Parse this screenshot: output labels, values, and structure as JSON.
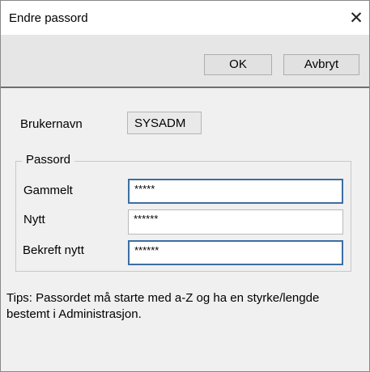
{
  "window": {
    "title": "Endre passord",
    "close_glyph": "✕",
    "close_icon": "close-icon"
  },
  "toolbar": {
    "ok_label": "OK",
    "cancel_label": "Avbryt"
  },
  "user": {
    "label": "Brukernavn",
    "value": "SYSADM"
  },
  "password_group": {
    "legend": "Passord",
    "old": {
      "label": "Gammelt",
      "value": "*****"
    },
    "new": {
      "label": "Nytt",
      "value": "******"
    },
    "confirm": {
      "label": "Bekreft nytt",
      "value": "******"
    }
  },
  "tips": "Tips: Passordet må starte med a-Z og ha en styrke/lengde bestemt i Administrasjon.",
  "colors": {
    "focus_border": "#3c6ea3",
    "separator": "#6f6f6f"
  }
}
